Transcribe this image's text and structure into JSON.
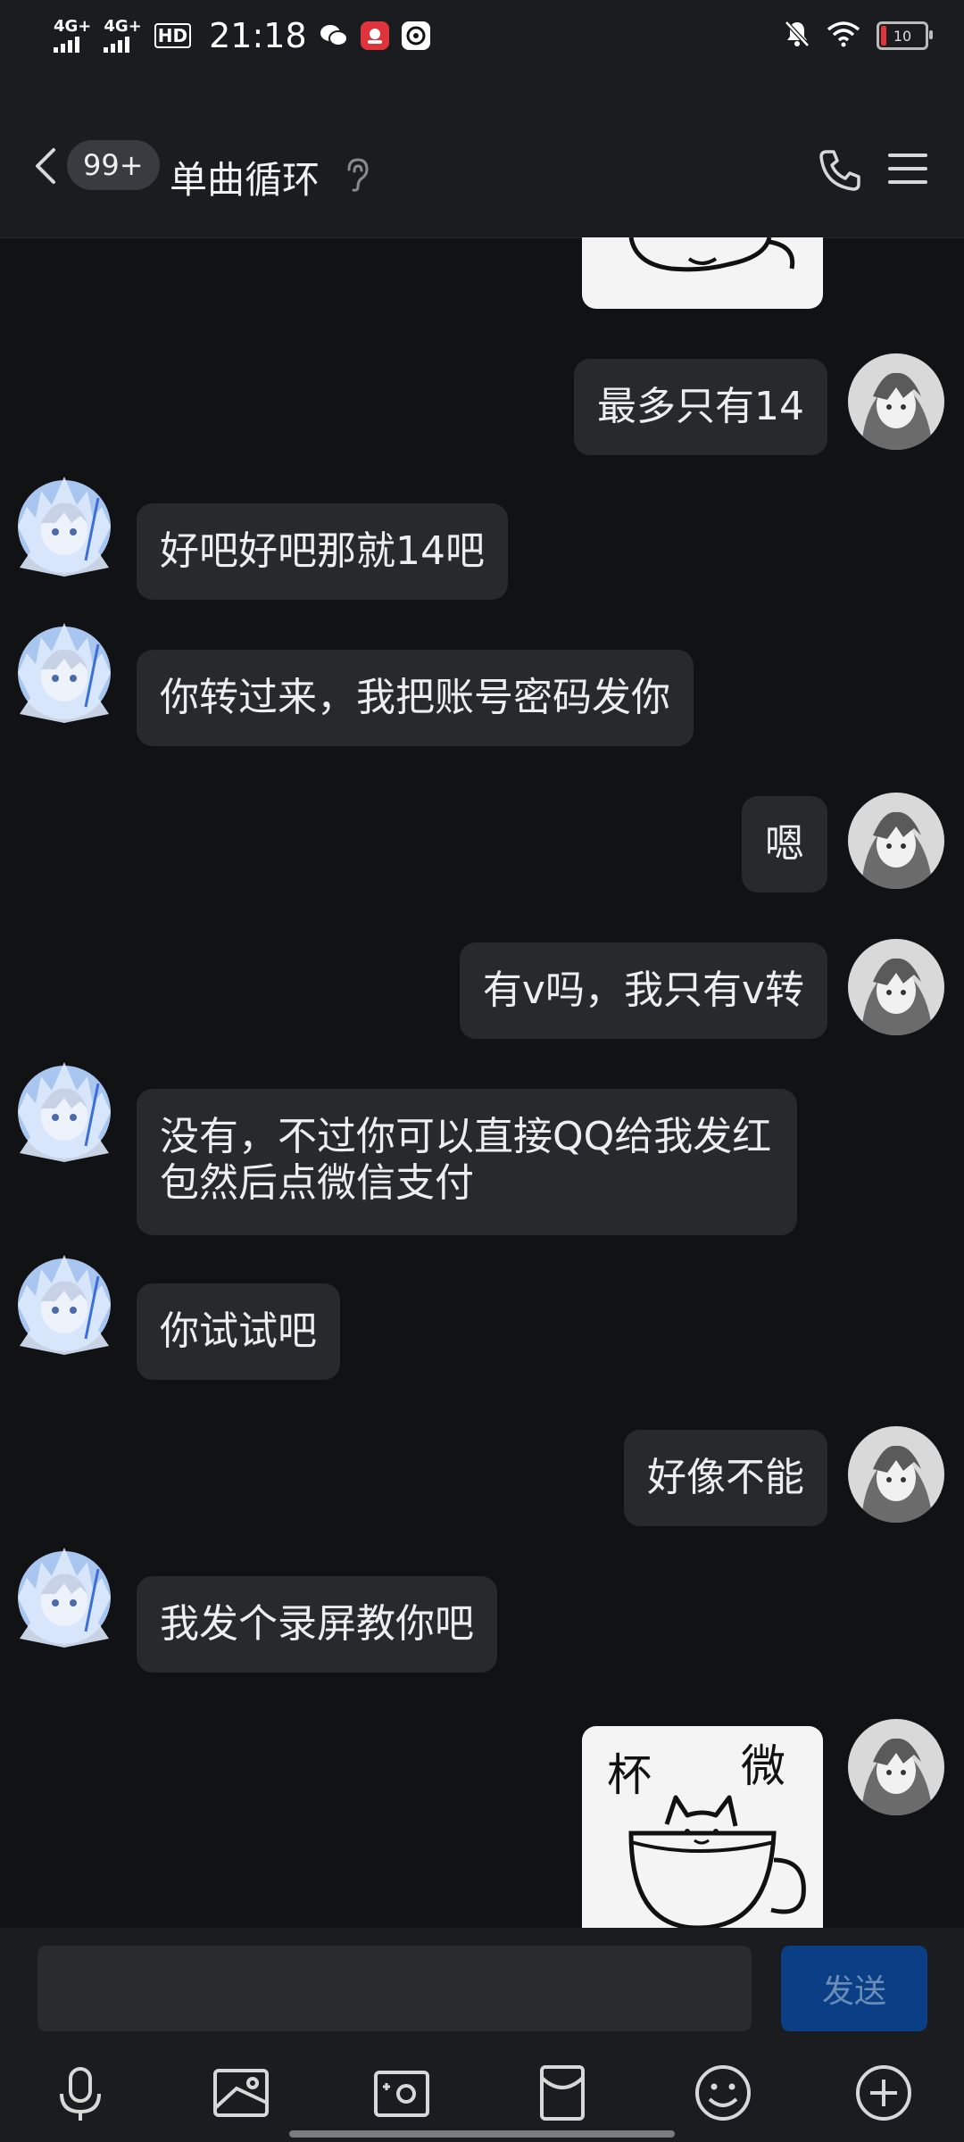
{
  "status_bar": {
    "signal1": "4G+",
    "signal2": "4G+",
    "hd": "HD",
    "time": "21:18",
    "battery": "10"
  },
  "header": {
    "unread_count": "99+",
    "title": "单曲循环"
  },
  "messages": [
    {
      "side": "right",
      "type": "sticker-partial"
    },
    {
      "side": "right",
      "text": "最多只有14"
    },
    {
      "side": "left",
      "text": "好吧好吧那就14吧"
    },
    {
      "side": "left",
      "text": "你转过来，我把账号密码发你"
    },
    {
      "side": "right",
      "text": "嗯"
    },
    {
      "side": "right",
      "text": "有v吗，我只有v转"
    },
    {
      "side": "left",
      "text": "没有，不过你可以直接QQ给我发红包然后点微信支付"
    },
    {
      "side": "left",
      "text": "你试试吧"
    },
    {
      "side": "right",
      "text": "好像不能"
    },
    {
      "side": "left",
      "text": "我发个录屏教你吧"
    },
    {
      "side": "right",
      "type": "sticker",
      "sticker_text_left": "杯",
      "sticker_text_right": "微"
    }
  ],
  "input": {
    "value": "",
    "send_label": "发送"
  },
  "toolbar": [
    "microphone-icon",
    "image-icon",
    "camera-icon",
    "red-packet-icon",
    "emoji-icon",
    "plus-icon"
  ]
}
